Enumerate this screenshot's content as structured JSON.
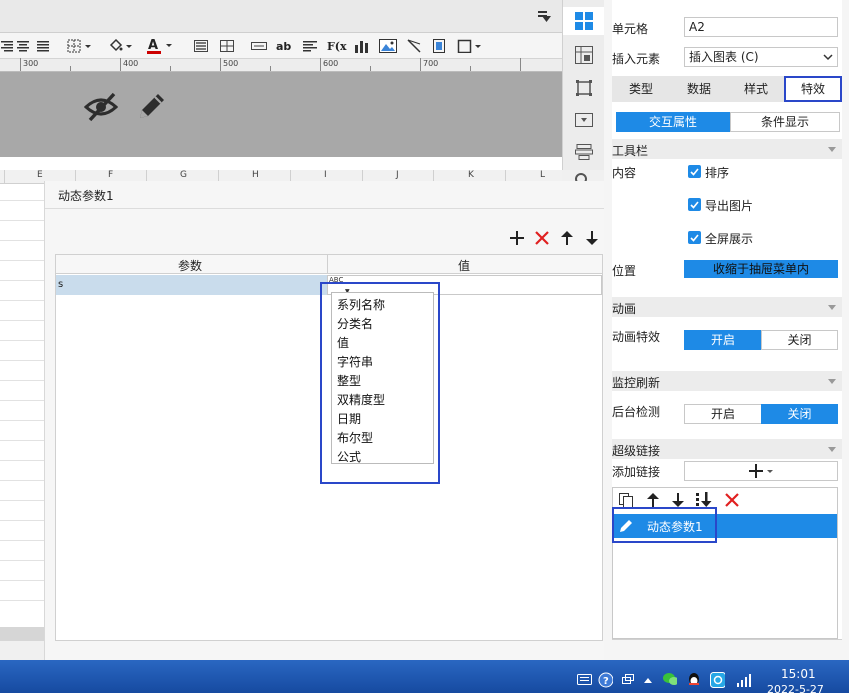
{
  "ruler": {
    "marks": [
      "300",
      "400",
      "500",
      "600",
      "700"
    ]
  },
  "columns": [
    "E",
    "F",
    "G",
    "H",
    "I",
    "J",
    "K",
    "L"
  ],
  "dialog": {
    "title": "动态参数1",
    "table": {
      "headers": [
        "参数",
        "值"
      ],
      "rows": [
        {
          "name": "s",
          "type_icon": "ABC"
        }
      ]
    },
    "type_options": [
      "系列名称",
      "分类名",
      "值",
      "字符串",
      "整型",
      "双精度型",
      "日期",
      "布尔型",
      "公式"
    ]
  },
  "panel": {
    "cell": {
      "label": "单元格",
      "value": "A2"
    },
    "insert": {
      "label": "插入元素",
      "value": "插入图表 (C)"
    },
    "tabs": [
      "类型",
      "数据",
      "样式",
      "特效"
    ],
    "subtabs": [
      "交互属性",
      "条件显示"
    ],
    "toolbar_section": "工具栏",
    "content": {
      "label": "内容",
      "options": [
        "排序",
        "导出图片",
        "全屏展示"
      ]
    },
    "position": {
      "label": "位置",
      "value": "收缩于抽屉菜单内"
    },
    "animation": {
      "section": "动画",
      "label": "动画特效",
      "on": "开启",
      "off": "关闭"
    },
    "monitor": {
      "section": "监控刷新",
      "label": "后台检测",
      "on": "开启",
      "off": "关闭"
    },
    "hyperlink": {
      "section": "超级链接",
      "add_label": "添加链接",
      "item": "动态参数1"
    }
  },
  "colors": {
    "accent": "#1e8ae6",
    "highlight": "#2a47c9",
    "delete": "#e02020"
  },
  "taskbar": {
    "time": "15:01",
    "date": "2022-5-27"
  }
}
